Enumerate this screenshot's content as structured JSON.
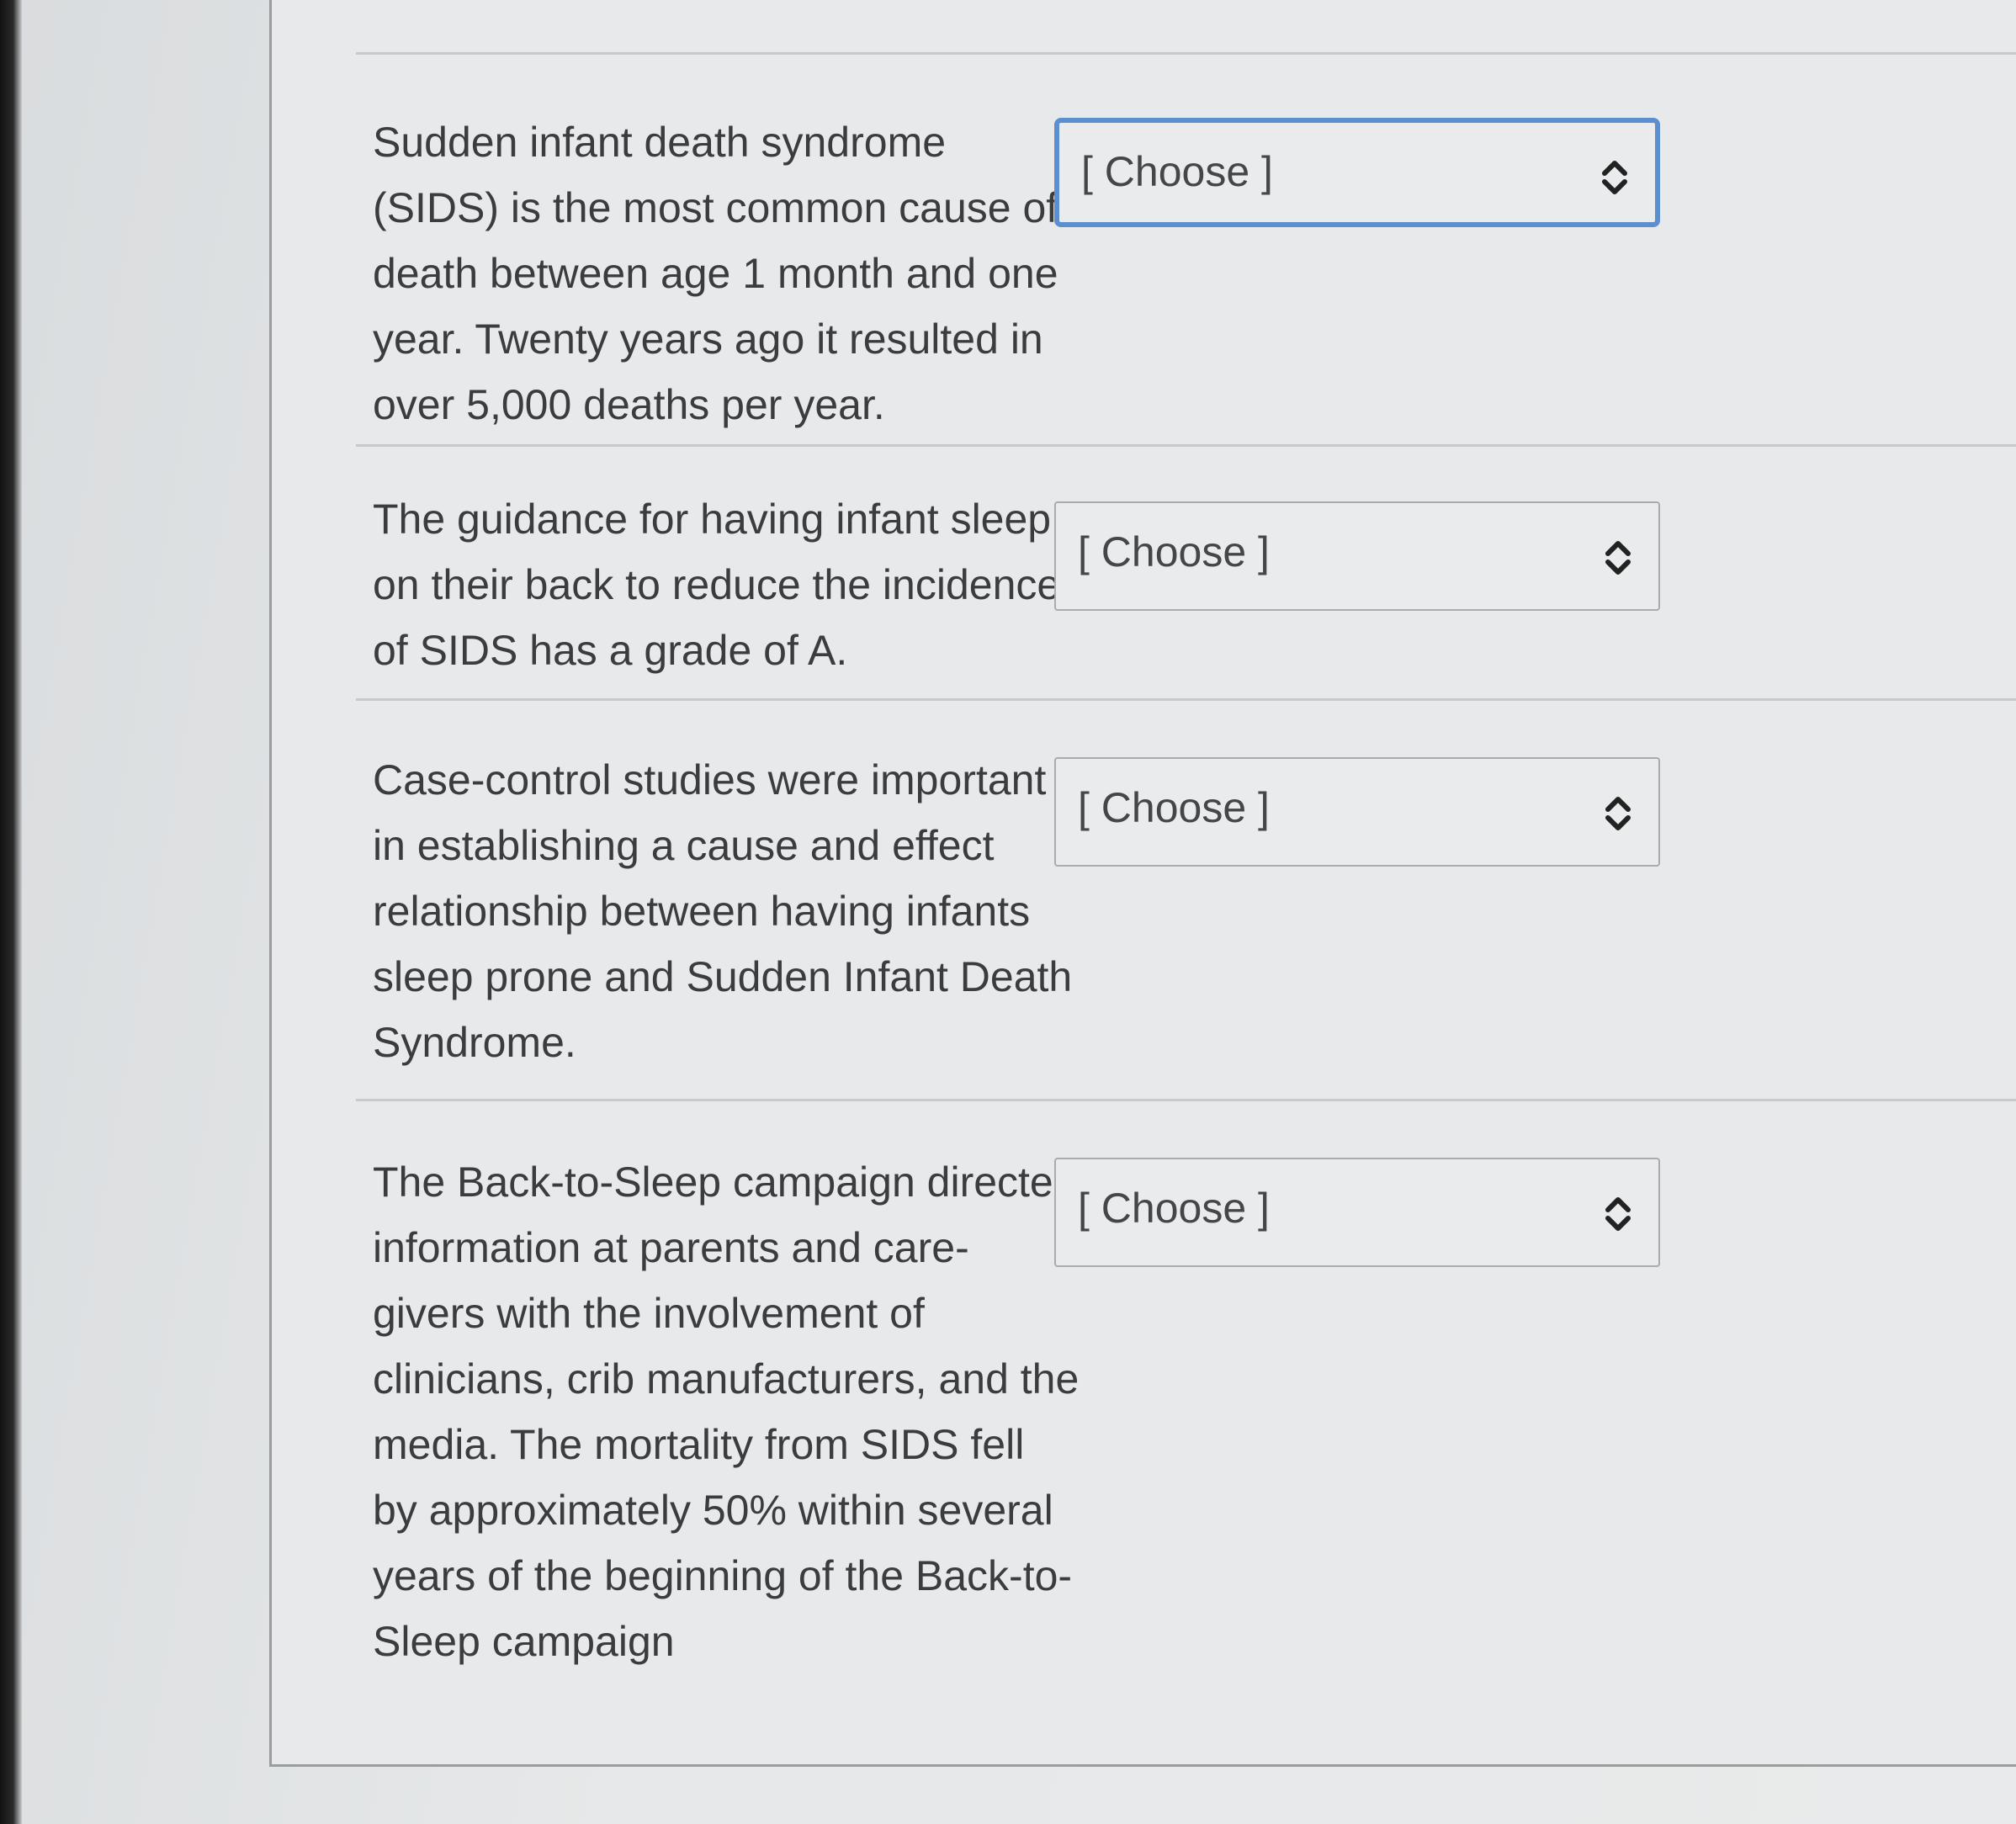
{
  "questions": [
    {
      "text": "Sudden infant death syndrome (SIDS) is the most common cause of death between age 1 month and one year. Twenty years ago it resulted in over 5,000 deaths per year.",
      "select": {
        "selected": "[ Choose ]"
      }
    },
    {
      "text": "The guidance for having infant sleep on their back to reduce the incidence of SIDS has a grade of A.",
      "select": {
        "selected": "[ Choose ]"
      }
    },
    {
      "text": "Case-control studies were important in establishing a cause and effect relationship between having infants sleep prone and Sudden Infant Death Syndrome.",
      "select": {
        "selected": "[ Choose ]"
      }
    },
    {
      "text": "The Back-to-Sleep campaign directed information at parents and care-givers with the involvement of clinicians, crib manufacturers, and the media. The mortality from SIDS fell by approximately 50% within several years of the beginning of the Back-to-Sleep campaign",
      "select": {
        "selected": "[ Choose ]"
      }
    }
  ],
  "icons": {
    "select_arrow": "chevron-up-down-icon"
  },
  "colors": {
    "focus_border": "#5b8fd0",
    "text": "#3a3c3e"
  }
}
